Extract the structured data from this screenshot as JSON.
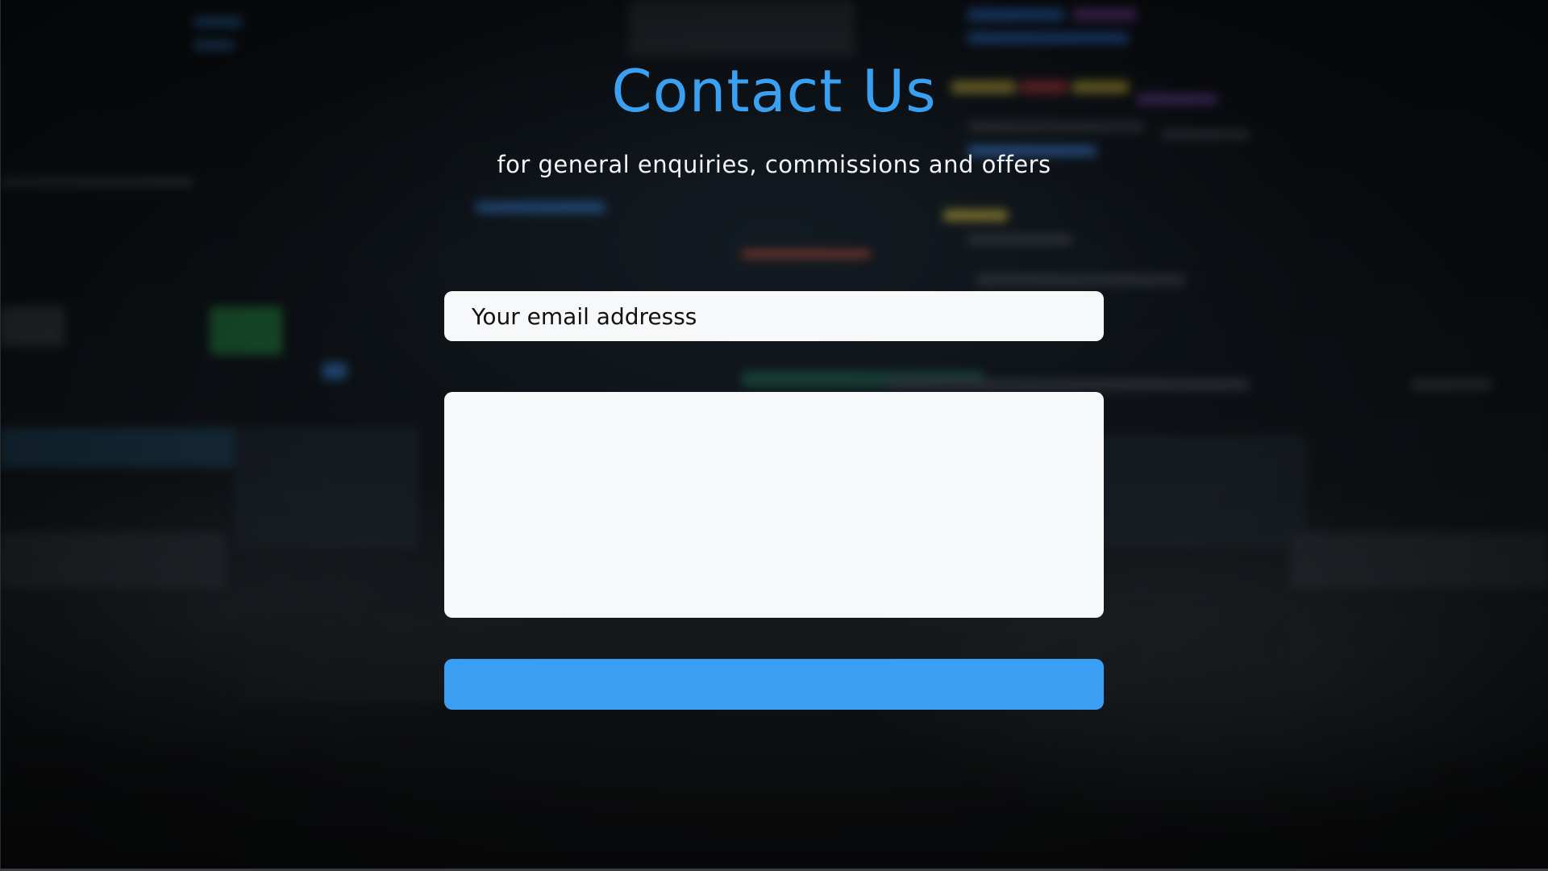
{
  "header": {
    "title": "Contact Us",
    "subtitle": "for general enquiries,  commissions and offers"
  },
  "form": {
    "email_placeholder": "Your email addresss",
    "email_value": "",
    "message_placeholder": "",
    "message_value": "",
    "submit_label": ""
  },
  "colors": {
    "accent": "#3a9ff3",
    "field_background": "#f7f8f9",
    "page_background": "#0a0d10"
  }
}
